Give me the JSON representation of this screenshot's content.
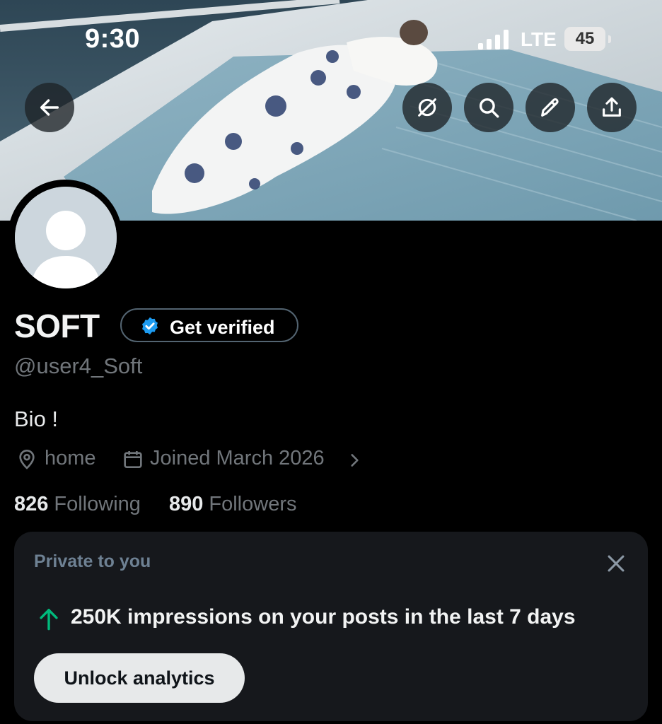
{
  "status_bar": {
    "time": "9:30",
    "network": "LTE",
    "battery": "45"
  },
  "header_actions": {
    "back": "arrow-left-icon",
    "grok": "grok-icon",
    "search": "search-icon",
    "edit": "pencil-icon",
    "share": "share-icon"
  },
  "profile": {
    "display_name": "SOFT",
    "verify_label": "Get verified",
    "handle": "@user4_Soft",
    "bio": "Bio !",
    "location": "home",
    "joined": "Joined March 2026",
    "following_count": "826",
    "following_label": "Following",
    "followers_count": "890",
    "followers_label": "Followers"
  },
  "analytics_card": {
    "title": "Private to you",
    "message": "250K impressions on your posts in the last 7 days",
    "button_label": "Unlock analytics"
  },
  "colors": {
    "background": "#000000",
    "card": "#16181c",
    "verified": "#1d9bf0",
    "accent_up": "#00ba7c"
  }
}
